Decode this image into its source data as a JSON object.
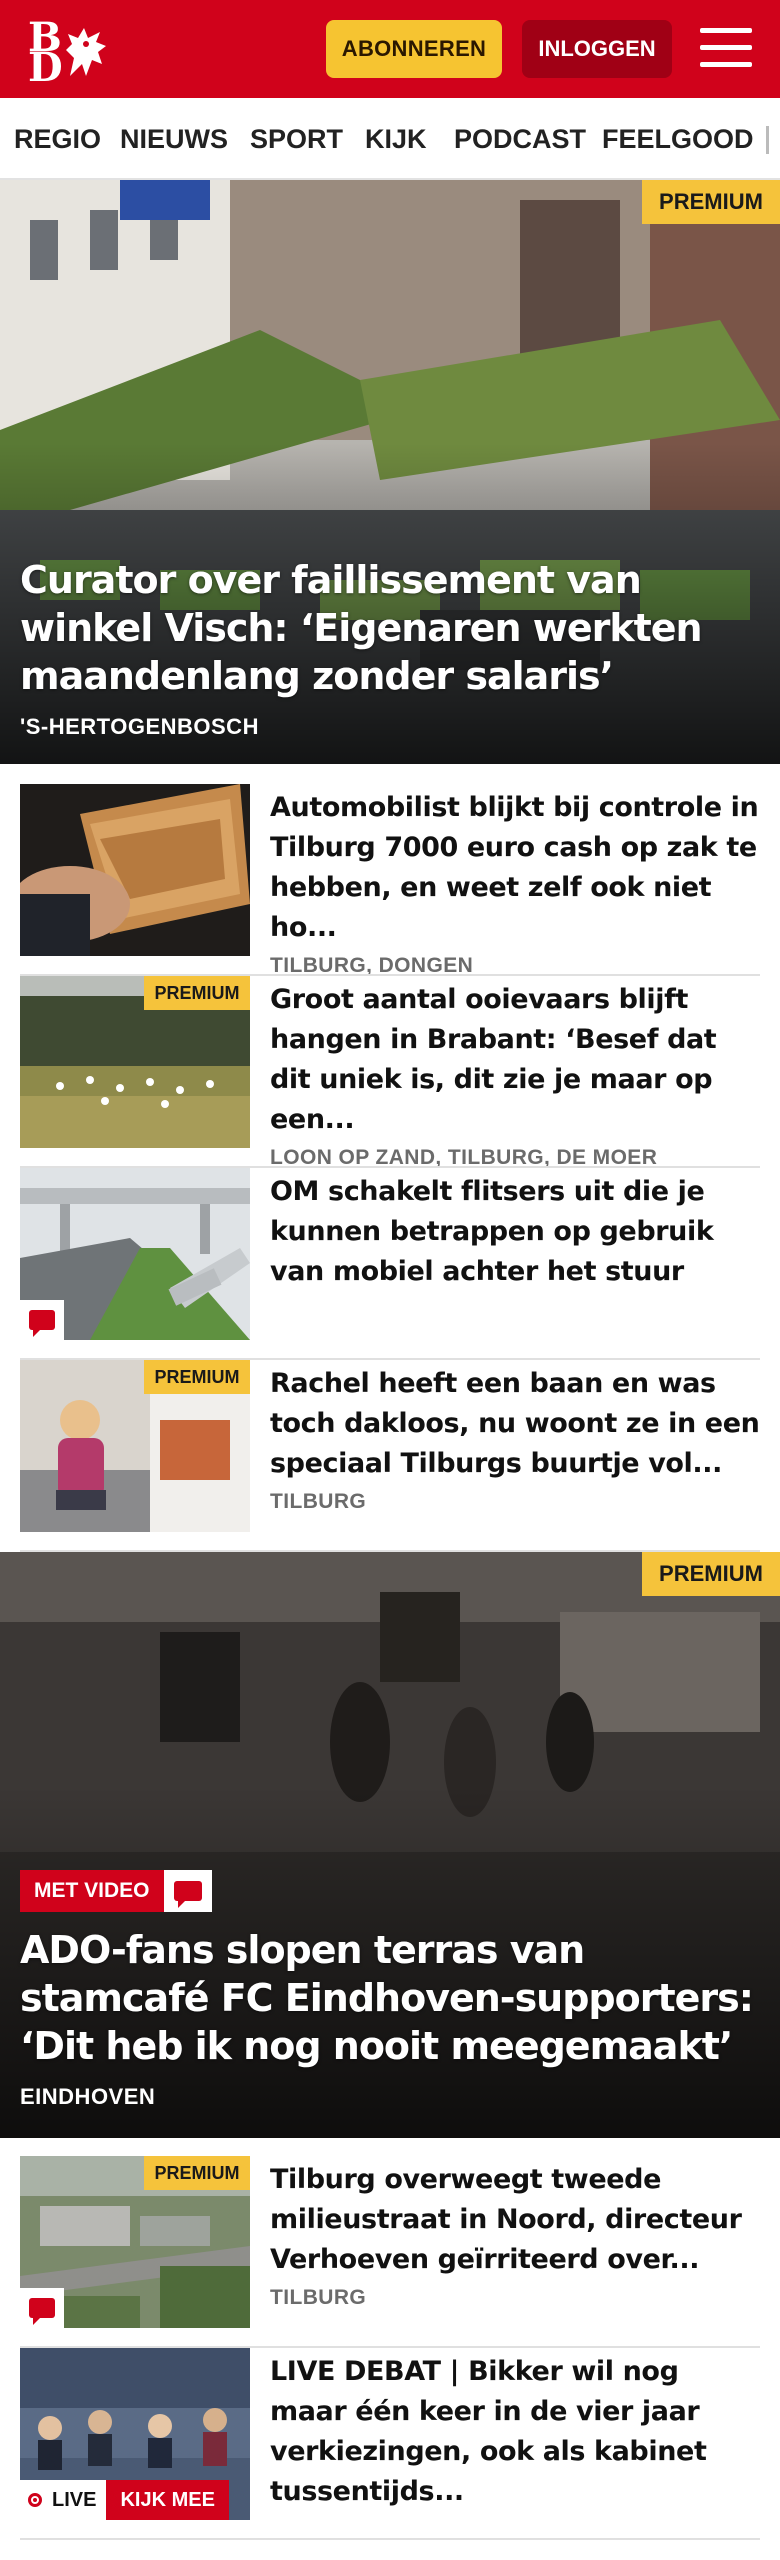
{
  "header": {
    "logo_top": "B",
    "logo_bottom": "D",
    "subscribe_label": "ABONNEREN",
    "login_label": "INLOGGEN"
  },
  "nav": {
    "items": [
      "REGIO",
      "NIEUWS",
      "SPORT",
      "KIJK",
      "PODCAST",
      "FEELGOOD"
    ]
  },
  "premium_label": "PREMIUM",
  "hero1": {
    "title": "Curator over faillissement van winkel Visch: ‘Eigenaren werkten maanden­lang zonder salaris’",
    "location": "'S-HERTOGENBOSCH",
    "premium": true
  },
  "items1": [
    {
      "title": "Automobilist blijkt bij controle in Tilburg 7000 euro cash op zak te hebben, en weet zelf ook niet ho...",
      "location": "TILBURG, DONGEN"
    },
    {
      "title": "Groot aantal ooievaars blijft hangen in Brabant: ‘Besef dat dit uniek is, dit zie je maar op een...",
      "location": "LOON OP ZAND, TILBURG, DE MOER"
    },
    {
      "title": "OM schakelt flitsers uit die je kunnen betrappen op gebruik van mobiel achter het stuur",
      "location": ""
    },
    {
      "title": "Rachel heeft een baan en was toch dakloos, nu woont ze in een speciaal Tilburgs buurtje vol...",
      "location": "TILBURG"
    }
  ],
  "hero2": {
    "tag": "MET VIDEO",
    "title": "ADO-fans slopen terras van stamcafé FC Eindhoven-supporters: ‘Dit heb ik nog nooit meegemaakt’",
    "location": "EINDHOVEN"
  },
  "items2": [
    {
      "title": "Tilburg overweegt tweede milieustraat in Noord, directeur Verhoeven geïrriteerd over...",
      "location": "TILBURG"
    },
    {
      "title": "LIVE DEBAT | Bikker wil nog maar één keer in de vier jaar verkiezin­gen, ook als kabinet tussentijds...",
      "location": ""
    }
  ],
  "live": {
    "live_label": "LIVE",
    "watch_label": "KIJK MEE"
  },
  "colors": {
    "brand_red": "#d0021b",
    "premium_yellow": "#f5c33b",
    "subscribe_yellow": "#f6c431",
    "login_dark_red": "#a00015"
  }
}
